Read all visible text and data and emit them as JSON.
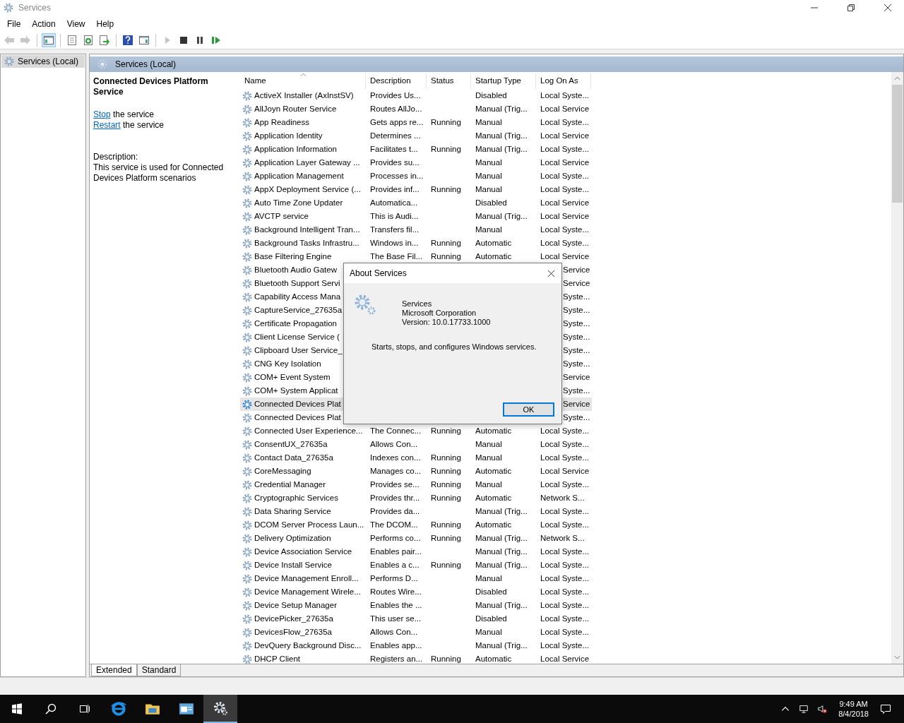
{
  "window": {
    "title": "Services"
  },
  "menu": [
    "File",
    "Action",
    "View",
    "Help"
  ],
  "toolbar": [
    {
      "buttons": [
        {
          "kind": "back",
          "disabled": true,
          "pressed": false
        },
        {
          "kind": "forward",
          "disabled": true,
          "pressed": false
        }
      ]
    },
    {
      "buttons": [
        {
          "kind": "console-tree",
          "disabled": false,
          "pressed": true
        }
      ]
    },
    {
      "buttons": [
        {
          "kind": "properties",
          "disabled": false,
          "pressed": false
        },
        {
          "kind": "refresh",
          "disabled": false,
          "pressed": false
        },
        {
          "kind": "export",
          "disabled": false,
          "pressed": false
        }
      ]
    },
    {
      "buttons": [
        {
          "kind": "help",
          "disabled": false,
          "pressed": false
        },
        {
          "kind": "action-pane",
          "disabled": false,
          "pressed": false
        }
      ]
    },
    {
      "buttons": [
        {
          "kind": "start",
          "disabled": true,
          "pressed": false
        },
        {
          "kind": "stop",
          "disabled": false,
          "pressed": false
        },
        {
          "kind": "pause",
          "disabled": false,
          "pressed": false
        },
        {
          "kind": "resume",
          "disabled": false,
          "pressed": false
        }
      ]
    }
  ],
  "tree": [
    {
      "label": "Services (Local)",
      "selected": true
    }
  ],
  "header": "Services (Local)",
  "details": {
    "title": "Connected Devices Platform Service",
    "actions": [
      {
        "link": "Stop",
        "text": " the service"
      },
      {
        "link": "Restart",
        "text": " the service"
      }
    ],
    "description_label": "Description:",
    "description": "This service is used for Connected Devices Platform scenarios"
  },
  "table": {
    "columns": [
      "Name",
      "Description",
      "Status",
      "Startup Type",
      "Log On As"
    ],
    "rows": [
      {
        "kind": "row",
        "selected": false,
        "name": "ActiveX Installer (AxInstSV)",
        "description": "Provides Us...",
        "status": "",
        "startup": "Disabled",
        "logon": "Local Syste..."
      },
      {
        "kind": "row",
        "selected": false,
        "name": "AllJoyn Router Service",
        "description": "Routes AllJo...",
        "status": "",
        "startup": "Manual (Trig...",
        "logon": "Local Service"
      },
      {
        "kind": "row",
        "selected": false,
        "name": "App Readiness",
        "description": "Gets apps re...",
        "status": "Running",
        "startup": "Manual",
        "logon": "Local Syste..."
      },
      {
        "kind": "row",
        "selected": false,
        "name": "Application Identity",
        "description": "Determines ...",
        "status": "",
        "startup": "Manual (Trig...",
        "logon": "Local Service"
      },
      {
        "kind": "row",
        "selected": false,
        "name": "Application Information",
        "description": "Facilitates t...",
        "status": "Running",
        "startup": "Manual (Trig...",
        "logon": "Local Syste..."
      },
      {
        "kind": "row",
        "selected": false,
        "name": "Application Layer Gateway ...",
        "description": "Provides su...",
        "status": "",
        "startup": "Manual",
        "logon": "Local Service"
      },
      {
        "kind": "row",
        "selected": false,
        "name": "Application Management",
        "description": "Processes in...",
        "status": "",
        "startup": "Manual",
        "logon": "Local Syste..."
      },
      {
        "kind": "row",
        "selected": false,
        "name": "AppX Deployment Service (...",
        "description": "Provides inf...",
        "status": "Running",
        "startup": "Manual",
        "logon": "Local Syste..."
      },
      {
        "kind": "row",
        "selected": false,
        "name": "Auto Time Zone Updater",
        "description": "Automatica...",
        "status": "",
        "startup": "Disabled",
        "logon": "Local Service"
      },
      {
        "kind": "row",
        "selected": false,
        "name": "AVCTP service",
        "description": "This is Audi...",
        "status": "",
        "startup": "Manual (Trig...",
        "logon": "Local Service"
      },
      {
        "kind": "row",
        "selected": false,
        "name": "Background Intelligent Tran...",
        "description": "Transfers fil...",
        "status": "",
        "startup": "Manual",
        "logon": "Local Syste..."
      },
      {
        "kind": "row",
        "selected": false,
        "name": "Background Tasks Infrastru...",
        "description": "Windows in...",
        "status": "Running",
        "startup": "Automatic",
        "logon": "Local Syste..."
      },
      {
        "kind": "row",
        "selected": false,
        "name": "Base Filtering Engine",
        "description": "The Base Fil...",
        "status": "Running",
        "startup": "Automatic",
        "logon": "Local Service"
      },
      {
        "kind": "partly_hidden",
        "selected": false,
        "name": "Bluetooth Audio Gatew",
        "logon": "Service"
      },
      {
        "kind": "partly_hidden",
        "selected": false,
        "name": "Bluetooth Support Servi",
        "logon": "Service"
      },
      {
        "kind": "partly_hidden",
        "selected": false,
        "name": "Capability Access Mana",
        "logon": "Syste..."
      },
      {
        "kind": "partly_hidden",
        "selected": false,
        "name": "CaptureService_27635a",
        "logon": "Syste..."
      },
      {
        "kind": "partly_hidden",
        "selected": false,
        "name": "Certificate Propagation",
        "logon": "Syste..."
      },
      {
        "kind": "partly_hidden",
        "selected": false,
        "name": "Client License Service (",
        "logon": "Syste..."
      },
      {
        "kind": "partly_hidden",
        "selected": false,
        "name": "Clipboard User Service_",
        "logon": "Syste..."
      },
      {
        "kind": "partly_hidden",
        "selected": false,
        "name": "CNG Key Isolation",
        "logon": "Syste..."
      },
      {
        "kind": "partly_hidden",
        "selected": false,
        "name": "COM+ Event System",
        "logon": "Service"
      },
      {
        "kind": "partly_hidden",
        "selected": false,
        "name": "COM+ System Applicat",
        "logon": "Syste..."
      },
      {
        "kind": "partly_hidden",
        "selected": true,
        "name": "Connected Devices Plat",
        "logon": "Service"
      },
      {
        "kind": "partly_hidden",
        "selected": false,
        "name": "Connected Devices Plat",
        "logon": "Syste..."
      },
      {
        "kind": "row",
        "selected": false,
        "name": "Connected User Experience...",
        "description": "The Connec...",
        "status": "Running",
        "startup": "Automatic",
        "logon": "Local Syste..."
      },
      {
        "kind": "row",
        "selected": false,
        "name": "ConsentUX_27635a",
        "description": "Allows Con...",
        "status": "",
        "startup": "Manual",
        "logon": "Local Syste..."
      },
      {
        "kind": "row",
        "selected": false,
        "name": "Contact Data_27635a",
        "description": "Indexes con...",
        "status": "Running",
        "startup": "Manual",
        "logon": "Local Syste..."
      },
      {
        "kind": "row",
        "selected": false,
        "name": "CoreMessaging",
        "description": "Manages co...",
        "status": "Running",
        "startup": "Automatic",
        "logon": "Local Service"
      },
      {
        "kind": "row",
        "selected": false,
        "name": "Credential Manager",
        "description": "Provides se...",
        "status": "Running",
        "startup": "Manual",
        "logon": "Local Syste..."
      },
      {
        "kind": "row",
        "selected": false,
        "name": "Cryptographic Services",
        "description": "Provides thr...",
        "status": "Running",
        "startup": "Automatic",
        "logon": "Network S..."
      },
      {
        "kind": "row",
        "selected": false,
        "name": "Data Sharing Service",
        "description": "Provides da...",
        "status": "",
        "startup": "Manual (Trig...",
        "logon": "Local Syste..."
      },
      {
        "kind": "row",
        "selected": false,
        "name": "DCOM Server Process Laun...",
        "description": "The DCOM...",
        "status": "Running",
        "startup": "Automatic",
        "logon": "Local Syste..."
      },
      {
        "kind": "row",
        "selected": false,
        "name": "Delivery Optimization",
        "description": "Performs co...",
        "status": "Running",
        "startup": "Manual (Trig...",
        "logon": "Network S..."
      },
      {
        "kind": "row",
        "selected": false,
        "name": "Device Association Service",
        "description": "Enables pair...",
        "status": "",
        "startup": "Manual (Trig...",
        "logon": "Local Syste..."
      },
      {
        "kind": "row",
        "selected": false,
        "name": "Device Install Service",
        "description": "Enables a c...",
        "status": "Running",
        "startup": "Manual (Trig...",
        "logon": "Local Syste..."
      },
      {
        "kind": "row",
        "selected": false,
        "name": "Device Management Enroll...",
        "description": "Performs D...",
        "status": "",
        "startup": "Manual",
        "logon": "Local Syste..."
      },
      {
        "kind": "row",
        "selected": false,
        "name": "Device Management Wirele...",
        "description": "Routes Wire...",
        "status": "",
        "startup": "Disabled",
        "logon": "Local Syste..."
      },
      {
        "kind": "row",
        "selected": false,
        "name": "Device Setup Manager",
        "description": "Enables the ...",
        "status": "",
        "startup": "Manual (Trig...",
        "logon": "Local Syste..."
      },
      {
        "kind": "row",
        "selected": false,
        "name": "DevicePicker_27635a",
        "description": "This user se...",
        "status": "",
        "startup": "Disabled",
        "logon": "Local Syste..."
      },
      {
        "kind": "row",
        "selected": false,
        "name": "DevicesFlow_27635a",
        "description": "Allows Con...",
        "status": "",
        "startup": "Manual",
        "logon": "Local Syste..."
      },
      {
        "kind": "row",
        "selected": false,
        "name": "DevQuery Background Disc...",
        "description": "Enables app...",
        "status": "",
        "startup": "Manual (Trig...",
        "logon": "Local Syste..."
      },
      {
        "kind": "row",
        "selected": false,
        "name": "DHCP Client",
        "description": "Registers an...",
        "status": "Running",
        "startup": "Automatic",
        "logon": "Local Service"
      }
    ]
  },
  "view_tabs": [
    {
      "label": "Extended",
      "selected": true
    },
    {
      "label": "Standard",
      "selected": false
    }
  ],
  "dialog": {
    "title": "About Services",
    "app": "Services",
    "company": "Microsoft Corporation",
    "version": "Version: 10.0.17733.1000",
    "description": "Starts, stops, and configures Windows services.",
    "button": "OK"
  },
  "taskbar": {
    "items": [
      {
        "kind": "start",
        "active": false
      },
      {
        "kind": "search",
        "active": false
      },
      {
        "kind": "task-view",
        "active": false
      },
      {
        "kind": "browser",
        "active": false
      },
      {
        "kind": "folder",
        "active": false
      },
      {
        "kind": "app-window",
        "active": false
      },
      {
        "kind": "services",
        "active": true
      }
    ],
    "time": "9:49 AM",
    "date": "8/4/2018"
  }
}
